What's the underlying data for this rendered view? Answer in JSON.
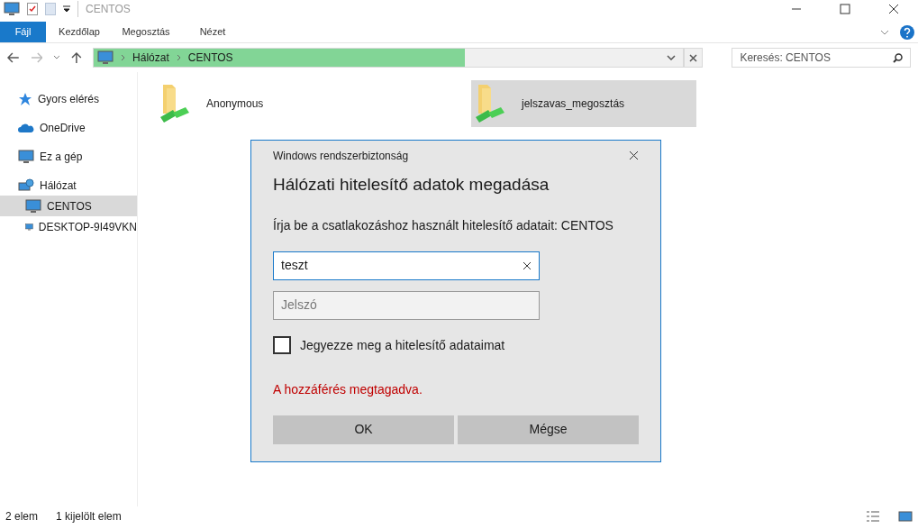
{
  "window": {
    "title": "CENTOS"
  },
  "ribbon_tabs": [
    {
      "label": "Fájl",
      "selected": true
    },
    {
      "label": "Kezdőlap",
      "selected": false
    },
    {
      "label": "Megosztás",
      "selected": false
    },
    {
      "label": "Nézet",
      "selected": false
    }
  ],
  "address_bar": {
    "crumbs": [
      "Hálózat",
      "CENTOS"
    ],
    "level": 0.63
  },
  "search": {
    "placeholder": "Keresés: CENTOS"
  },
  "sidebar": {
    "items": [
      {
        "label": "Gyors elérés",
        "kind": "star",
        "selected": false
      },
      {
        "label": "OneDrive",
        "kind": "cloud",
        "selected": false
      },
      {
        "label": "Ez a gép",
        "kind": "pc",
        "selected": false
      },
      {
        "label": "Hálózat",
        "kind": "network",
        "selected": false,
        "children": [
          {
            "label": "CENTOS",
            "kind": "pc",
            "selected": true
          },
          {
            "label": "DESKTOP-9I49VKN",
            "kind": "pc",
            "selected": false
          }
        ]
      }
    ]
  },
  "folders": [
    {
      "name": "Anonymous",
      "selected": false
    },
    {
      "name": "jelszavas_megosztás",
      "selected": true
    }
  ],
  "dialog": {
    "caption": "Windows rendszerbiztonság",
    "heading": "Hálózati hitelesítő adatok megadása",
    "prompt": "Írja be a csatlakozáshoz használt hitelesítő adatait: CENTOS",
    "username": "teszt",
    "password_placeholder": "Jelszó",
    "remember": {
      "label": "Jegyezze meg a hitelesítő adataimat",
      "checked": false
    },
    "error": "A hozzáférés megtagadva.",
    "buttons": [
      "OK",
      "Mégse"
    ]
  },
  "status_bar": [
    "2 elem",
    "1 kijelölt elem"
  ]
}
